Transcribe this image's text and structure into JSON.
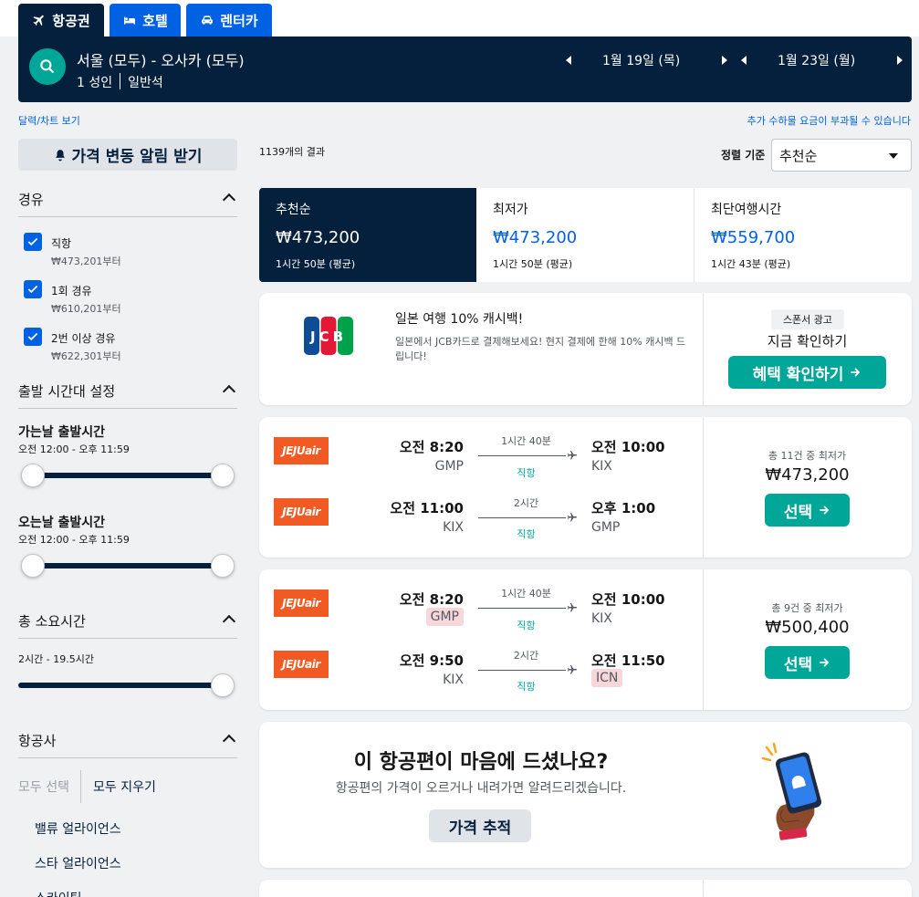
{
  "tabs": [
    {
      "label": "항공권",
      "icon": "plane-icon",
      "active": true
    },
    {
      "label": "호텔",
      "icon": "bed-icon"
    },
    {
      "label": "렌터카",
      "icon": "car-icon"
    }
  ],
  "search": {
    "route": "서울 (모두) - 오사카 (모두)",
    "travellers": "1 성인",
    "cabin": "일반석",
    "depart_date": "1월 19일 (목)",
    "return_date": "1월 23일 (월)"
  },
  "links": {
    "calendar": "달력/차트 보기",
    "fees": "추가 수하물 요금이 부과될 수 있습니다"
  },
  "sidebar": {
    "alert_button": "가격 변동 알림 받기",
    "stops": {
      "title": "경유",
      "options": [
        {
          "label": "직항",
          "price": "₩473,201부터",
          "checked": true
        },
        {
          "label": "1회 경유",
          "price": "₩610,201부터",
          "checked": true
        },
        {
          "label": "2번 이상 경유",
          "price": "₩622,301부터",
          "checked": true
        }
      ]
    },
    "times": {
      "title": "출발 시간대 설정",
      "outbound_label": "가는날 출발시간",
      "outbound_range": "오전 12:00 - 오후 11:59",
      "return_label": "오는날 출발시간",
      "return_range": "오전 12:00 - 오후 11:59"
    },
    "duration": {
      "title": "총 소요시간",
      "range": "2시간 - 19.5시간"
    },
    "airlines": {
      "title": "항공사",
      "select_all": "모두 선택",
      "clear_all": "모두 지우기",
      "items": [
        "밸류 얼라이언스",
        "스타 얼라이언스",
        "스카이팀"
      ]
    }
  },
  "results": {
    "count": "1139개의 결과",
    "sort_label": "정렬 기준",
    "sort_value": "추천순",
    "sort_tabs": [
      {
        "title": "추천순",
        "price": "₩473,200",
        "sub": "1시간 50분 (평균)",
        "active": true
      },
      {
        "title": "최저가",
        "price": "₩473,200",
        "sub": "1시간 50분 (평균)"
      },
      {
        "title": "최단여행시간",
        "price": "₩559,700",
        "sub": "1시간 43분 (평균)"
      }
    ]
  },
  "ad": {
    "title": "일본 여행 10% 캐시백!",
    "body": "일본에서 JCB카드로 결제해보세요! 현지 결제에 한해 10% 캐시백 드립니다!",
    "sponsor": "스폰서 광고",
    "cta_text": "지금 확인하기",
    "button": "혜택 확인하기",
    "logo_text": "JCB"
  },
  "flights": [
    {
      "legs": [
        {
          "airline": "JEJUair",
          "dep_time": "오전 8:20",
          "dep_code": "GMP",
          "duration": "1시간 40분",
          "stops": "직항",
          "arr_time": "오전 10:00",
          "arr_code": "KIX"
        },
        {
          "airline": "JEJUair",
          "dep_time": "오전 11:00",
          "dep_code": "KIX",
          "duration": "2시간",
          "stops": "직항",
          "arr_time": "오후 1:00",
          "arr_code": "GMP"
        }
      ],
      "deal_count": "총 11건 중 최저가",
      "price": "₩473,200",
      "button": "선택"
    },
    {
      "legs": [
        {
          "airline": "JEJUair",
          "dep_time": "오전 8:20",
          "dep_code": "GMP",
          "duration": "1시간 40분",
          "stops": "직항",
          "arr_time": "오전 10:00",
          "arr_code": "KIX"
        },
        {
          "airline": "JEJUair",
          "dep_time": "오전 9:50",
          "dep_code": "KIX",
          "duration": "2시간",
          "stops": "직항",
          "arr_time": "오전 11:50",
          "arr_code": "ICN"
        }
      ],
      "deal_count": "총 9건 중 최저가",
      "price": "₩500,400",
      "button": "선택"
    }
  ],
  "tracker": {
    "title": "이 항공편이 마음에 드셨나요?",
    "subtitle": "항공편의 가격이 오르거나 내려가면 알려드리겠습니다.",
    "button": "가격 추적"
  },
  "colors": {
    "navy": "#05203c",
    "blue": "#0062e3",
    "teal": "#00a698",
    "jeju": "#f15a22",
    "highlight": "#f8d7da"
  }
}
